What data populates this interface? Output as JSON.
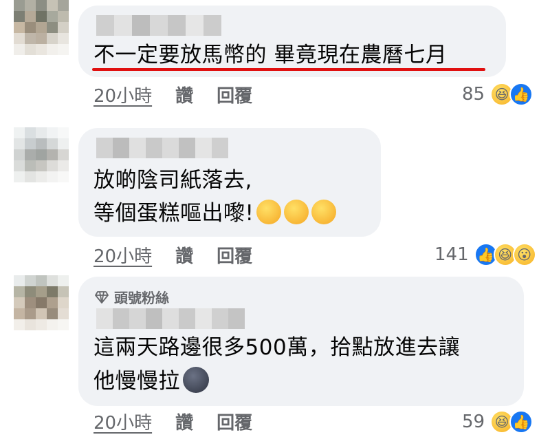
{
  "comments": [
    {
      "text_lines": [
        "不一定要放馬幣的 畢竟現在農曆七月"
      ],
      "time": "20小時",
      "like_label": "讚",
      "reply_label": "回覆",
      "reaction_count": "85",
      "reactions": [
        "haha-icon",
        "like-icon"
      ]
    },
    {
      "text_lines": [
        "放啲陰司紙落去,",
        "等個蛋糕嘔出嚟!"
      ],
      "inline_emojis": [
        "rolling-laughing-emoji",
        "rolling-laughing-emoji",
        "rolling-laughing-emoji"
      ],
      "time": "20小時",
      "like_label": "讚",
      "reply_label": "回覆",
      "reaction_count": "141",
      "reactions": [
        "like-icon",
        "haha-icon",
        "wow-icon"
      ]
    },
    {
      "badge": "頭號粉絲",
      "text_lines": [
        "這兩天路邊很多500萬，拾點放進去讓",
        "他慢慢拉"
      ],
      "inline_emojis": [
        "new-moon-face-emoji"
      ],
      "time": "20小時",
      "like_label": "讚",
      "reply_label": "回覆",
      "reaction_count": "59",
      "reactions": [
        "haha-icon",
        "like-icon"
      ]
    }
  ],
  "colors": {
    "bubble": "#f0f2f5",
    "underline": "#e01010",
    "meta_text": "#65676b",
    "like_blue": "#1877f2"
  }
}
